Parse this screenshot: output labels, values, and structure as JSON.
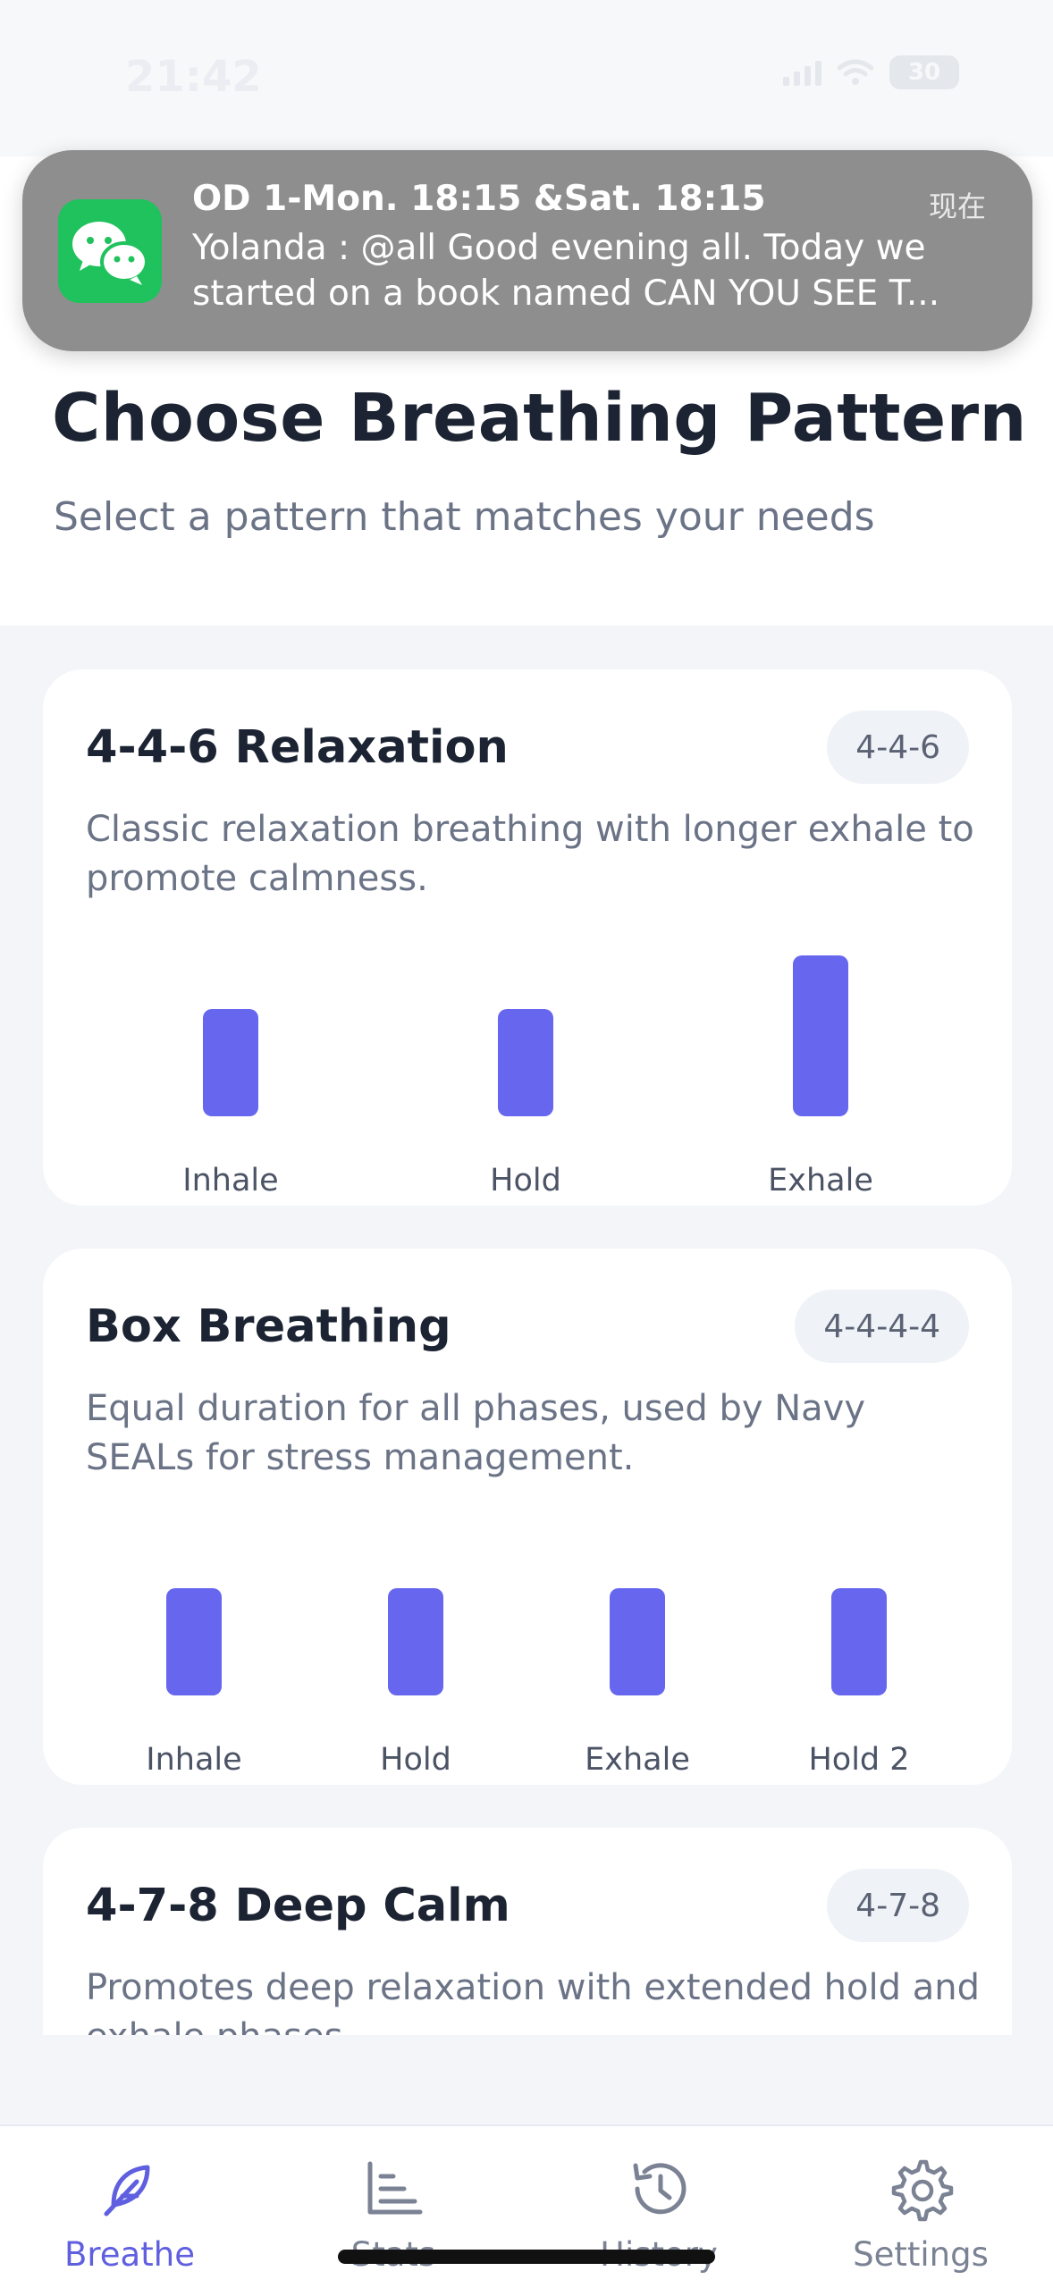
{
  "status_bar": {
    "time": "21:42",
    "battery": "30"
  },
  "notification": {
    "app_icon": "wechat-icon",
    "title": "OD 1-Mon. 18:15 &Sat. 18:15",
    "time": "现在",
    "body_line1": "Yolanda : @all Good evening all. Today we",
    "body_line2": "started on a book named CAN YOU SEE T..."
  },
  "header": {
    "title": "Choose Breathing Pattern",
    "subtitle": "Select a pattern that matches your needs"
  },
  "patterns": [
    {
      "name": "4-4-6 Relaxation",
      "badge": "4-4-6",
      "description": "Classic relaxation breathing with longer exhale to promote calmness.",
      "phases": [
        {
          "label": "Inhale",
          "seconds": 4
        },
        {
          "label": "Hold",
          "seconds": 4
        },
        {
          "label": "Exhale",
          "seconds": 6
        }
      ]
    },
    {
      "name": "Box Breathing",
      "badge": "4-4-4-4",
      "description": "Equal duration for all phases, used by Navy SEALs for stress management.",
      "phases": [
        {
          "label": "Inhale",
          "seconds": 4
        },
        {
          "label": "Hold",
          "seconds": 4
        },
        {
          "label": "Exhale",
          "seconds": 4
        },
        {
          "label": "Hold 2",
          "seconds": 4
        }
      ]
    },
    {
      "name": "4-7-8 Deep Calm",
      "badge": "4-7-8",
      "description": "Promotes deep relaxation with extended hold and exhale phases."
    }
  ],
  "tabs": [
    {
      "label": "Breathe",
      "icon": "feather-icon",
      "active": true
    },
    {
      "label": "Stats",
      "icon": "bar-chart-icon",
      "active": false
    },
    {
      "label": "History",
      "icon": "history-icon",
      "active": false
    },
    {
      "label": "Settings",
      "icon": "gear-icon",
      "active": false
    }
  ],
  "colors": {
    "accent": "#6666ee",
    "active_tab": "#5f5fe0",
    "wechat_green": "#1fc25c"
  }
}
